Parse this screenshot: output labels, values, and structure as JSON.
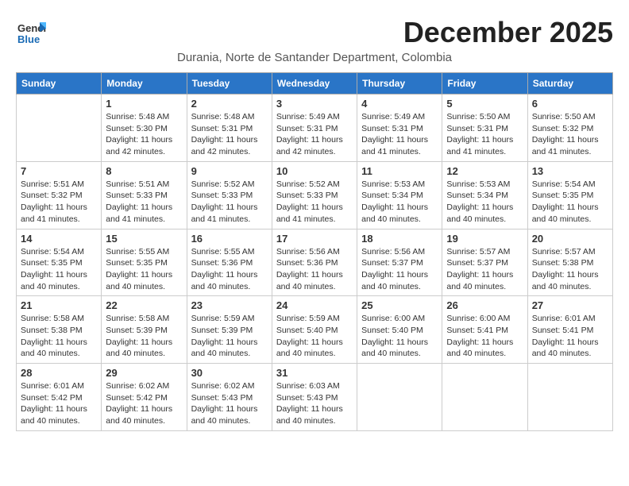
{
  "logo": {
    "general": "General",
    "blue": "Blue"
  },
  "title": "December 2025",
  "subtitle": "Durania, Norte de Santander Department, Colombia",
  "days_of_week": [
    "Sunday",
    "Monday",
    "Tuesday",
    "Wednesday",
    "Thursday",
    "Friday",
    "Saturday"
  ],
  "weeks": [
    [
      {
        "day": "",
        "info": ""
      },
      {
        "day": "1",
        "info": "Sunrise: 5:48 AM\nSunset: 5:30 PM\nDaylight: 11 hours\nand 42 minutes."
      },
      {
        "day": "2",
        "info": "Sunrise: 5:48 AM\nSunset: 5:31 PM\nDaylight: 11 hours\nand 42 minutes."
      },
      {
        "day": "3",
        "info": "Sunrise: 5:49 AM\nSunset: 5:31 PM\nDaylight: 11 hours\nand 42 minutes."
      },
      {
        "day": "4",
        "info": "Sunrise: 5:49 AM\nSunset: 5:31 PM\nDaylight: 11 hours\nand 41 minutes."
      },
      {
        "day": "5",
        "info": "Sunrise: 5:50 AM\nSunset: 5:31 PM\nDaylight: 11 hours\nand 41 minutes."
      },
      {
        "day": "6",
        "info": "Sunrise: 5:50 AM\nSunset: 5:32 PM\nDaylight: 11 hours\nand 41 minutes."
      }
    ],
    [
      {
        "day": "7",
        "info": "Sunrise: 5:51 AM\nSunset: 5:32 PM\nDaylight: 11 hours\nand 41 minutes."
      },
      {
        "day": "8",
        "info": "Sunrise: 5:51 AM\nSunset: 5:33 PM\nDaylight: 11 hours\nand 41 minutes."
      },
      {
        "day": "9",
        "info": "Sunrise: 5:52 AM\nSunset: 5:33 PM\nDaylight: 11 hours\nand 41 minutes."
      },
      {
        "day": "10",
        "info": "Sunrise: 5:52 AM\nSunset: 5:33 PM\nDaylight: 11 hours\nand 41 minutes."
      },
      {
        "day": "11",
        "info": "Sunrise: 5:53 AM\nSunset: 5:34 PM\nDaylight: 11 hours\nand 40 minutes."
      },
      {
        "day": "12",
        "info": "Sunrise: 5:53 AM\nSunset: 5:34 PM\nDaylight: 11 hours\nand 40 minutes."
      },
      {
        "day": "13",
        "info": "Sunrise: 5:54 AM\nSunset: 5:35 PM\nDaylight: 11 hours\nand 40 minutes."
      }
    ],
    [
      {
        "day": "14",
        "info": "Sunrise: 5:54 AM\nSunset: 5:35 PM\nDaylight: 11 hours\nand 40 minutes."
      },
      {
        "day": "15",
        "info": "Sunrise: 5:55 AM\nSunset: 5:35 PM\nDaylight: 11 hours\nand 40 minutes."
      },
      {
        "day": "16",
        "info": "Sunrise: 5:55 AM\nSunset: 5:36 PM\nDaylight: 11 hours\nand 40 minutes."
      },
      {
        "day": "17",
        "info": "Sunrise: 5:56 AM\nSunset: 5:36 PM\nDaylight: 11 hours\nand 40 minutes."
      },
      {
        "day": "18",
        "info": "Sunrise: 5:56 AM\nSunset: 5:37 PM\nDaylight: 11 hours\nand 40 minutes."
      },
      {
        "day": "19",
        "info": "Sunrise: 5:57 AM\nSunset: 5:37 PM\nDaylight: 11 hours\nand 40 minutes."
      },
      {
        "day": "20",
        "info": "Sunrise: 5:57 AM\nSunset: 5:38 PM\nDaylight: 11 hours\nand 40 minutes."
      }
    ],
    [
      {
        "day": "21",
        "info": "Sunrise: 5:58 AM\nSunset: 5:38 PM\nDaylight: 11 hours\nand 40 minutes."
      },
      {
        "day": "22",
        "info": "Sunrise: 5:58 AM\nSunset: 5:39 PM\nDaylight: 11 hours\nand 40 minutes."
      },
      {
        "day": "23",
        "info": "Sunrise: 5:59 AM\nSunset: 5:39 PM\nDaylight: 11 hours\nand 40 minutes."
      },
      {
        "day": "24",
        "info": "Sunrise: 5:59 AM\nSunset: 5:40 PM\nDaylight: 11 hours\nand 40 minutes."
      },
      {
        "day": "25",
        "info": "Sunrise: 6:00 AM\nSunset: 5:40 PM\nDaylight: 11 hours\nand 40 minutes."
      },
      {
        "day": "26",
        "info": "Sunrise: 6:00 AM\nSunset: 5:41 PM\nDaylight: 11 hours\nand 40 minutes."
      },
      {
        "day": "27",
        "info": "Sunrise: 6:01 AM\nSunset: 5:41 PM\nDaylight: 11 hours\nand 40 minutes."
      }
    ],
    [
      {
        "day": "28",
        "info": "Sunrise: 6:01 AM\nSunset: 5:42 PM\nDaylight: 11 hours\nand 40 minutes."
      },
      {
        "day": "29",
        "info": "Sunrise: 6:02 AM\nSunset: 5:42 PM\nDaylight: 11 hours\nand 40 minutes."
      },
      {
        "day": "30",
        "info": "Sunrise: 6:02 AM\nSunset: 5:43 PM\nDaylight: 11 hours\nand 40 minutes."
      },
      {
        "day": "31",
        "info": "Sunrise: 6:03 AM\nSunset: 5:43 PM\nDaylight: 11 hours\nand 40 minutes."
      },
      {
        "day": "",
        "info": ""
      },
      {
        "day": "",
        "info": ""
      },
      {
        "day": "",
        "info": ""
      }
    ]
  ]
}
